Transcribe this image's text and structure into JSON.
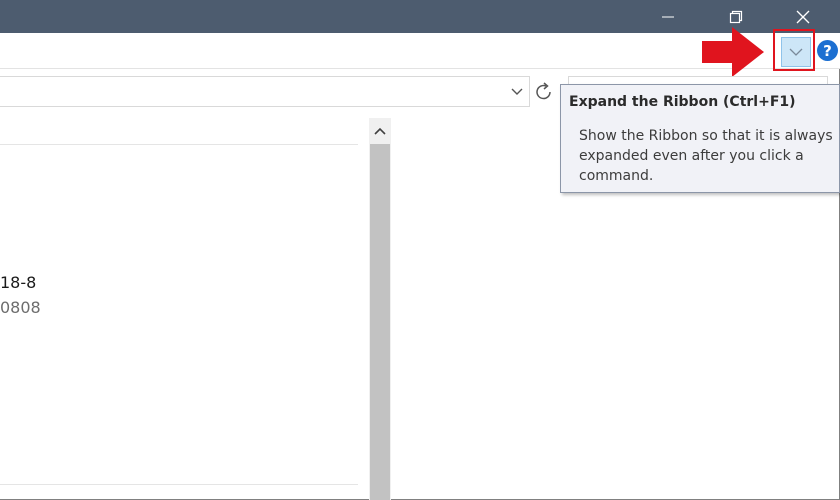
{
  "window": {
    "minimize_label": "Minimize",
    "restore_label": "Restore Down",
    "close_label": "Close",
    "title_bar_color": "#4d5c6f"
  },
  "ribbon": {
    "expand_button_icon": "chevron-down-icon",
    "help_icon_glyph": "?",
    "highlight_color": "#e0141e"
  },
  "tooltip": {
    "title": "Expand the Ribbon (Ctrl+F1)",
    "body": "Show the Ribbon so that it is always expanded even after you click a command."
  },
  "file_list": {
    "rows": [
      {
        "name": "18-8",
        "subtitle": "0808"
      }
    ]
  }
}
